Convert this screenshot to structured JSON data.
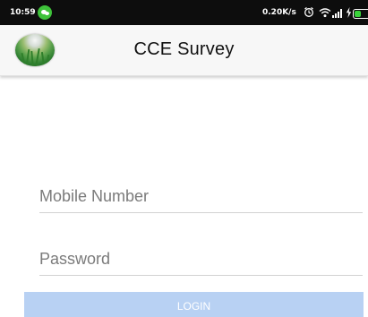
{
  "status_bar": {
    "time": "10:59",
    "network_speed": "0.20K/s",
    "battery_percent": "36",
    "battery_fill": 0.36,
    "icons": [
      "wechat-icon",
      "alarm-icon",
      "wifi-icon",
      "signal-icon",
      "charging-icon",
      "battery-icon"
    ]
  },
  "app_bar": {
    "title": "CCE Survey",
    "logo_icon": "rice-field-logo-icon"
  },
  "form": {
    "mobile_placeholder": "Mobile Number",
    "password_placeholder": "Password",
    "login_label": "LOGIN"
  },
  "colors": {
    "status_bar": "#0d0d0d",
    "app_bar": "#f7f7f7",
    "login_button": "#b8d1f3",
    "battery_green": "#39d43a",
    "wechat_green": "#3ec23a"
  }
}
